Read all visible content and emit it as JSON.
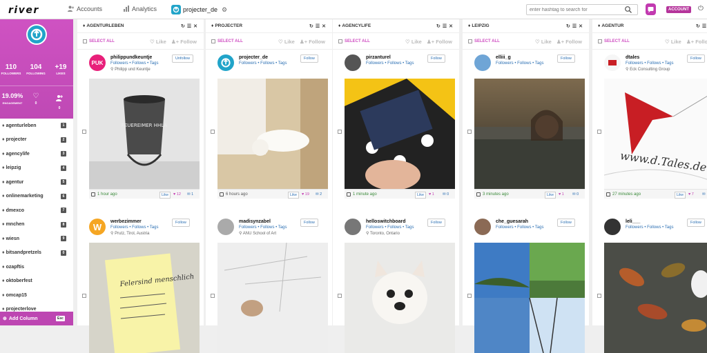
{
  "topbar": {
    "logo": "river",
    "nav": [
      {
        "label": "Accounts",
        "icon": "users-icon"
      },
      {
        "label": "Analytics",
        "icon": "bar-chart-icon"
      }
    ],
    "project": "projecter_de",
    "search_placeholder": "enter hashtag to search for",
    "account_label": "ACCOUNT"
  },
  "profile": {
    "followers": "110",
    "followers_label": "FOLLOWERS",
    "following": "104",
    "following_label": "FOLLOWING",
    "likes": "+19",
    "likes_label": "LIKES",
    "engagement": "19.09%",
    "engagement_label": "ENGAGEMENT",
    "hearts": "0",
    "adds": "0"
  },
  "projects": [
    {
      "name": "agenturleben",
      "count": "1"
    },
    {
      "name": "projecter",
      "count": "2"
    },
    {
      "name": "agencylife",
      "count": "3"
    },
    {
      "name": "leipzig",
      "count": "4"
    },
    {
      "name": "agentur",
      "count": "5"
    },
    {
      "name": "onlinemarketing",
      "count": "6"
    },
    {
      "name": "dmexco",
      "count": "7"
    },
    {
      "name": "mnchen",
      "count": "8"
    },
    {
      "name": "wiesn",
      "count": "9"
    },
    {
      "name": "bitsandpretzels",
      "count": "0"
    },
    {
      "name": "ozapftis",
      "count": ""
    },
    {
      "name": "oktoberfest",
      "count": ""
    },
    {
      "name": "omcap15",
      "count": ""
    },
    {
      "name": "projecterlove",
      "count": ""
    }
  ],
  "add_column": {
    "label": "Add Column",
    "esc": "Esc"
  },
  "common": {
    "select_all": "SELECT ALL",
    "like": "Like",
    "follow": "Follow",
    "links": "Followers • Follows • Tags",
    "like_btn": "Like"
  },
  "columns": [
    {
      "title": "AGENTURLEBEN",
      "cards": [
        {
          "user": "philippundkeuntje",
          "loc": "Philipp und Keuntje",
          "btn": "Unfollow",
          "time": "1 hour ago",
          "hearts": "12",
          "comments": "1"
        },
        {
          "user": "werbezimmer",
          "loc": "Prutz, Tirol, Austria",
          "btn": "Follow"
        }
      ]
    },
    {
      "title": "PROJECTER",
      "cards": [
        {
          "user": "projecter_de",
          "loc": "",
          "btn": "Follow",
          "time": "6 hours ago",
          "hearts": "19",
          "comments": "2"
        },
        {
          "user": "madisynzabel",
          "loc": "ANU School of Art",
          "btn": "Follow"
        }
      ]
    },
    {
      "title": "AGENCYLIFE",
      "cards": [
        {
          "user": "pirzanturel",
          "loc": "",
          "btn": "Follow",
          "time": "1 minute ago",
          "hearts": "1",
          "comments": "0"
        },
        {
          "user": "helloswitchboard",
          "loc": "Toronto, Ontario",
          "btn": "Follow"
        }
      ]
    },
    {
      "title": "LEIPZIG",
      "cards": [
        {
          "user": "elliii_g",
          "loc": "",
          "btn": "Follow",
          "time": "3 minutes ago",
          "hearts": "1",
          "comments": "0"
        },
        {
          "user": "che_guesarah",
          "loc": "",
          "btn": "Follow"
        }
      ]
    },
    {
      "title": "AGENTUR",
      "cards": [
        {
          "user": "dtales",
          "loc": "Eck Consulting Group",
          "btn": "Follow",
          "time": "27 minutes ago",
          "hearts": "7",
          "comments": ""
        },
        {
          "user": "leli___",
          "loc": "",
          "btn": "Follow"
        }
      ]
    }
  ],
  "image_text": {
    "bucket": "FEUEREIMER HHLA",
    "note": "Felersind menschlich",
    "dtales_sign": "www.d.Tales.de"
  }
}
